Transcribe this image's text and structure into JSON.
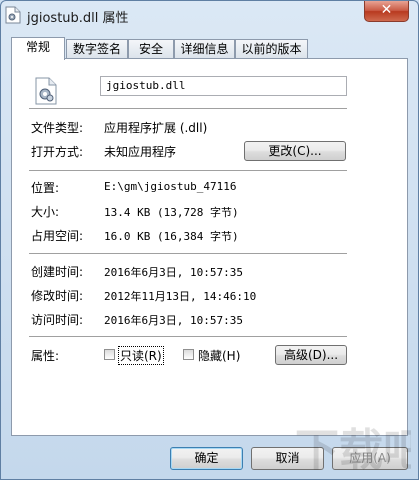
{
  "window": {
    "title": "jgiostub.dll 属性",
    "close_label": "✕"
  },
  "tabs": [
    {
      "label": "常规",
      "active": true
    },
    {
      "label": "数字签名",
      "active": false
    },
    {
      "label": "安全",
      "active": false
    },
    {
      "label": "详细信息",
      "active": false
    },
    {
      "label": "以前的版本",
      "active": false
    }
  ],
  "general": {
    "file_name": "jgiostub.dll",
    "file_type_label": "文件类型:",
    "file_type_value": "应用程序扩展 (.dll)",
    "open_with_label": "打开方式:",
    "open_with_value": "未知应用程序",
    "change_button": "更改(C)...",
    "location_label": "位置:",
    "location_value": "E:\\gm\\jgiostub_47116",
    "size_label": "大小:",
    "size_value": "13.4 KB (13,728 字节)",
    "size_on_disk_label": "占用空间:",
    "size_on_disk_value": "16.0 KB (16,384 字节)",
    "created_label": "创建时间:",
    "created_value": "2016年6月3日, 10:57:35",
    "modified_label": "修改时间:",
    "modified_value": "2012年11月13日, 14:46:10",
    "accessed_label": "访问时间:",
    "accessed_value": "2016年6月3日, 10:57:35",
    "attributes_label": "属性:",
    "readonly_label": "只读(R)",
    "readonly_checked": false,
    "hidden_label": "隐藏(H)",
    "hidden_checked": false,
    "advanced_button": "高级(D)..."
  },
  "footer": {
    "ok": "确定",
    "cancel": "取消",
    "apply": "应用(A)"
  },
  "watermark": {
    "brand": "下载吧"
  }
}
